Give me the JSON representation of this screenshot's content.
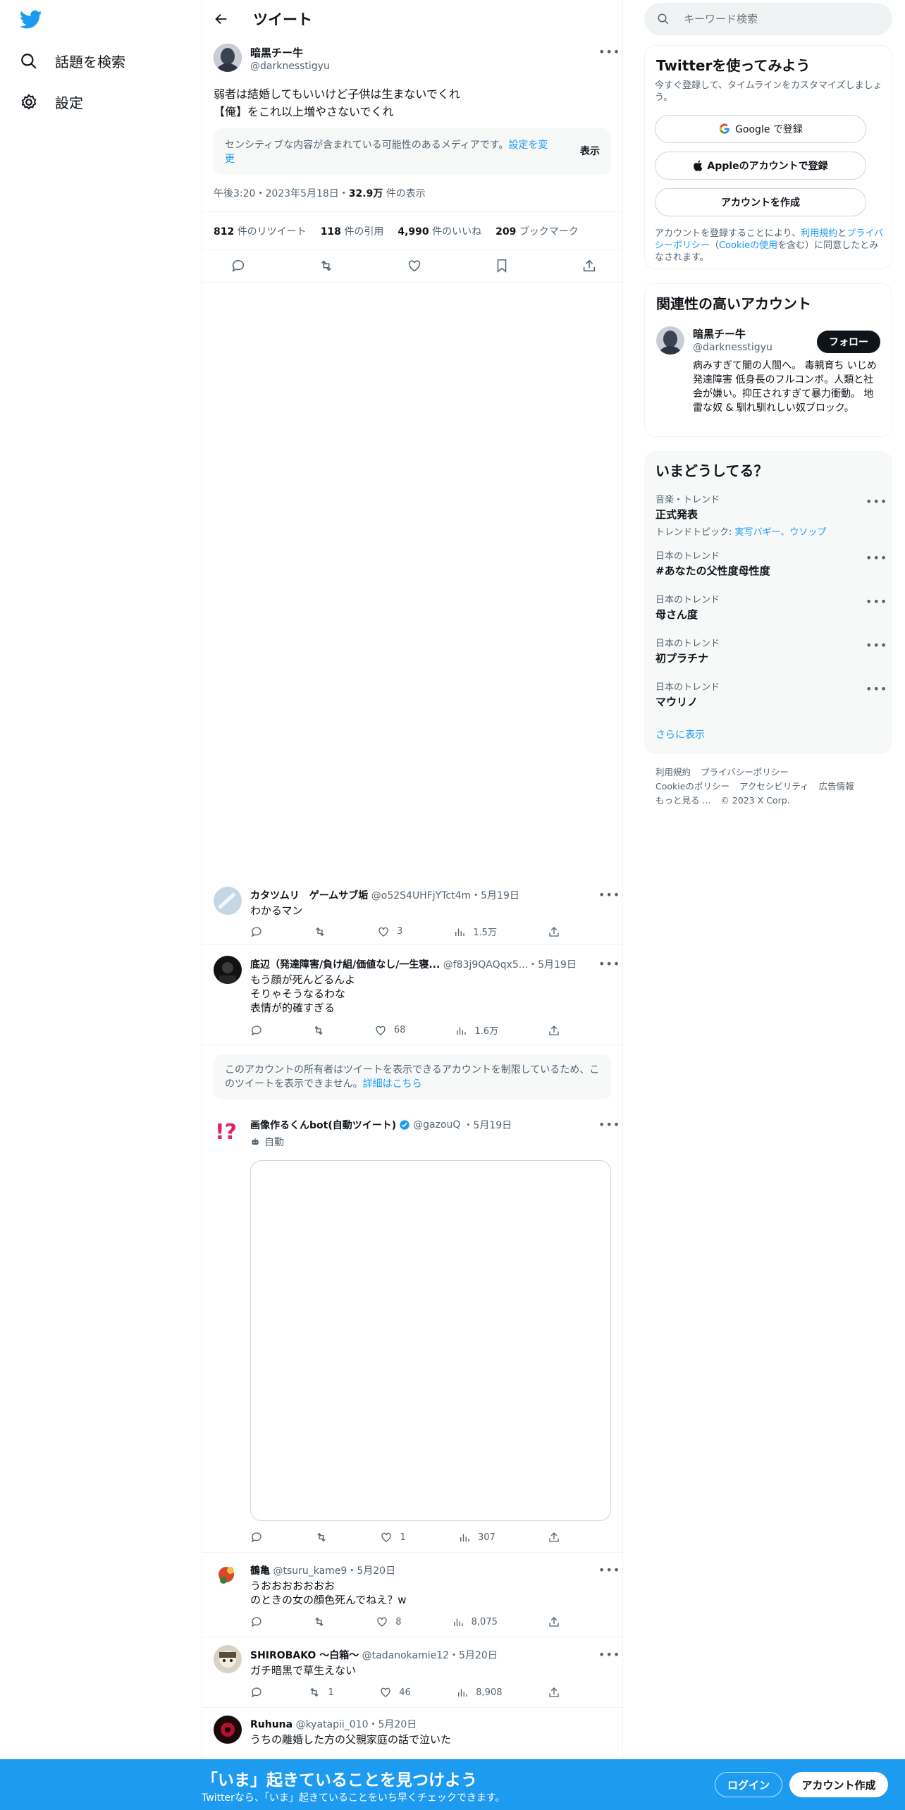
{
  "nav": {
    "explore_label": "話題を検索",
    "settings_label": "設定"
  },
  "header": {
    "title": "ツイート"
  },
  "main_tweet": {
    "name": "暗黒チー牛",
    "handle": "@darknesstigyu",
    "text_line1": "弱者は結婚してもいいけど子供は生まないでくれ",
    "text_line2": "【俺】をこれ以上増やさないでくれ",
    "sensitive_text": "センシティブな内容が含まれている可能性のあるメディアです。",
    "sensitive_link": "設定を変更",
    "show_label": "表示",
    "timestamp": "午後3:20・2023年5月18日・",
    "views_count": "32.9万",
    "views_label": "件の表示",
    "stats": [
      {
        "count": "812",
        "label": "件のリツイート"
      },
      {
        "count": "118",
        "label": "件の引用"
      },
      {
        "count": "4,990",
        "label": "件のいいね"
      },
      {
        "count": "209",
        "label": "ブックマーク"
      }
    ]
  },
  "replies": [
    {
      "name": "カタツムリ　ゲームサブ垢",
      "handle": "@o52S4UHFjYTct4m",
      "date": "・5月19日",
      "lines": [
        "わかるマン"
      ],
      "likes": "3",
      "views": "1.5万"
    },
    {
      "name": "底辺（発達障害/負け組/価値なし/一生寝...",
      "handle": "@f83j9QAQqx5...",
      "date": "・5月19日",
      "lines": [
        "もう顔が死んどるんよ",
        "そりゃそうなるわな",
        "表情が的確すぎる"
      ],
      "likes": "68",
      "views": "1.6万"
    }
  ],
  "restricted_notice": {
    "text": "このアカウントの所有者はツイートを表示できるアカウントを制限しているため、このツイートを表示できません。",
    "link": "詳細はこちら"
  },
  "bot_reply": {
    "name": "画像作るくんbot(自動ツイート)",
    "handle": "@gazouQ",
    "date": "・5月19日",
    "automated_label": "自動",
    "likes": "1",
    "views": "307"
  },
  "replies_after": [
    {
      "name": "鶴亀",
      "handle": "@tsuru_kame9",
      "date": "・5月20日",
      "lines": [
        "うおおおおおおお",
        "のときの女の顔色死んでねえ？w"
      ],
      "retweets": "",
      "likes": "8",
      "views": "8,075"
    },
    {
      "name": "SHIROBAKO 〜白箱〜",
      "handle": "@tadanokamie12",
      "date": "・5月20日",
      "lines": [
        "ガチ暗黒で草生えない"
      ],
      "retweets": "1",
      "likes": "46",
      "views": "8,908"
    },
    {
      "name": "Ruhuna",
      "handle": "@kyatapii_010",
      "date": "・5月20日",
      "lines": [
        "うちの離婚した方の父親家庭の話で泣いた"
      ]
    }
  ],
  "search": {
    "placeholder": "キーワード検索"
  },
  "signup_card": {
    "title": "Twitterを使ってみよう",
    "subtitle": "今すぐ登録して、タイムラインをカスタマイズしましょう。",
    "google_label": "Google で登録",
    "apple_label": "Appleのアカウントで登録",
    "create_label": "アカウントを作成",
    "terms_prefix": "アカウントを登録することにより、",
    "terms_link": "利用規約",
    "terms_and": "と",
    "privacy_link": "プライバシーポリシー",
    "cookie_link": "Cookieの使用",
    "terms_suffix": "を含む）に同意したとみなされます。",
    "terms_paren": "（"
  },
  "relevant_card": {
    "title": "関連性の高いアカウント",
    "name": "暗黒チー牛",
    "handle": "@darknesstigyu",
    "follow_label": "フォロー",
    "bio": "病みすぎて闇の人間へ。 毒親育ち いじめ 発達障害 低身長のフルコンボ。人類と社会が嫌い。抑圧されすぎて暴力衝動。 地雷な奴 & 馴れ馴れしい奴ブロック。"
  },
  "trends_card": {
    "title": "いまどうしてる？",
    "items": [
      {
        "label": "音楽・トレンド",
        "name": "正式発表",
        "topic_prefix": "トレンドトピック: ",
        "topic_links": "実写バギー、ウソップ"
      },
      {
        "label": "日本のトレンド",
        "name": "#あなたの父性度母性度"
      },
      {
        "label": "日本のトレンド",
        "name": "母さん度"
      },
      {
        "label": "日本のトレンド",
        "name": "初プラチナ"
      },
      {
        "label": "日本のトレンド",
        "name": "マウリノ"
      }
    ],
    "show_more": "さらに表示"
  },
  "footer": {
    "links": [
      "利用規約",
      "プライバシーポリシー",
      "Cookieのポリシー",
      "アクセシビリティ",
      "広告情報",
      "もっと見る ..."
    ],
    "copyright": "© 2023 X Corp."
  },
  "banner": {
    "headline": "「いま」起きていることを見つけよう",
    "sub": "Twitterなら、「いま」起きていることをいち早くチェックできます。",
    "login_label": "ログイン",
    "signup_label": "アカウント作成"
  },
  "colors": {
    "accent": "#1d9bf0",
    "text": "#0f1419",
    "muted": "#536471",
    "card_bg": "#f7f9f9"
  }
}
